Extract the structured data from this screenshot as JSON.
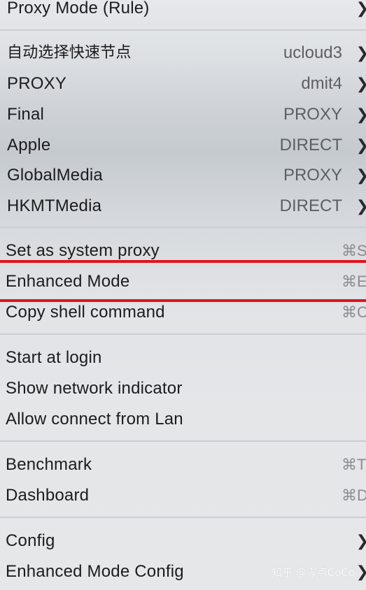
{
  "header": {
    "mode_label": "Proxy Mode (Rule)"
  },
  "proxy_groups": [
    {
      "name": "自动选择快速节点",
      "selected": "ucloud3"
    },
    {
      "name": "PROXY",
      "selected": "dmit4"
    },
    {
      "name": "Final",
      "selected": "PROXY"
    },
    {
      "name": "Apple",
      "selected": "DIRECT"
    },
    {
      "name": "GlobalMedia",
      "selected": "PROXY"
    },
    {
      "name": "HKMTMedia",
      "selected": "DIRECT"
    }
  ],
  "system_items": [
    {
      "label": "Set as system proxy",
      "shortcut": "⌘S"
    },
    {
      "label": "Enhanced Mode",
      "shortcut": "⌘E"
    },
    {
      "label": "Copy shell command",
      "shortcut": "⌘C"
    }
  ],
  "startup_items": [
    {
      "label": "Start at login"
    },
    {
      "label": "Show network indicator"
    },
    {
      "label": "Allow connect from Lan"
    }
  ],
  "tools_items": [
    {
      "label": "Benchmark",
      "shortcut": "⌘T"
    },
    {
      "label": "Dashboard",
      "shortcut": "⌘D"
    }
  ],
  "config_items": [
    {
      "label": "Config"
    },
    {
      "label": "Enhanced Mode Config"
    }
  ],
  "watermark": "知乎 @零点CoCo",
  "colors": {
    "highlight_box": "#e0141c",
    "menu_background": "#e4e6e8"
  }
}
